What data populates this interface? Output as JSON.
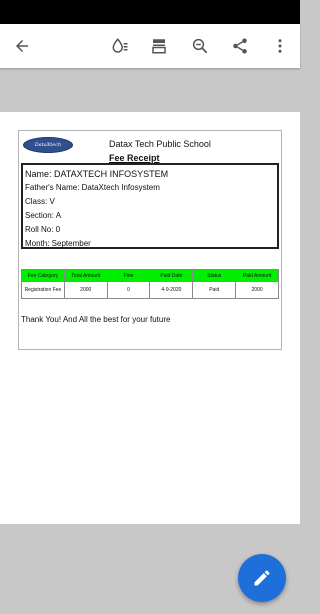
{
  "toolbar": {
    "icons": [
      "back-arrow-icon",
      "ink-drop-icon",
      "page-layout-icon",
      "zoom-out-icon",
      "share-icon",
      "more-vert-icon"
    ]
  },
  "receipt": {
    "logo_text": "DataXtech",
    "school_name": "Datax Tech Public School",
    "title": "Fee Receipt",
    "student": {
      "name": "Name: DATAXTECH INFOSYSTEM",
      "father": "Father's Name: DataXtech Infosystem",
      "class": "Class: V",
      "section": "Section: A",
      "roll": "Roll No: 0",
      "month": "Month: September"
    },
    "table": {
      "headers": [
        "Fee Category",
        "Total Amount",
        "Fine",
        "Paid Date",
        "Status",
        "Paid Amount"
      ],
      "rows": [
        [
          "Registration Fee",
          "2000",
          "0",
          "4-9-2020",
          "Paid",
          "2000"
        ]
      ]
    },
    "footer": "Thank You! And All the best for your future"
  },
  "fab": {
    "icon": "edit-pencil-icon"
  },
  "colors": {
    "table_header": "#00ee00",
    "fab": "#1e6fd9",
    "status_bar": "#000000"
  }
}
